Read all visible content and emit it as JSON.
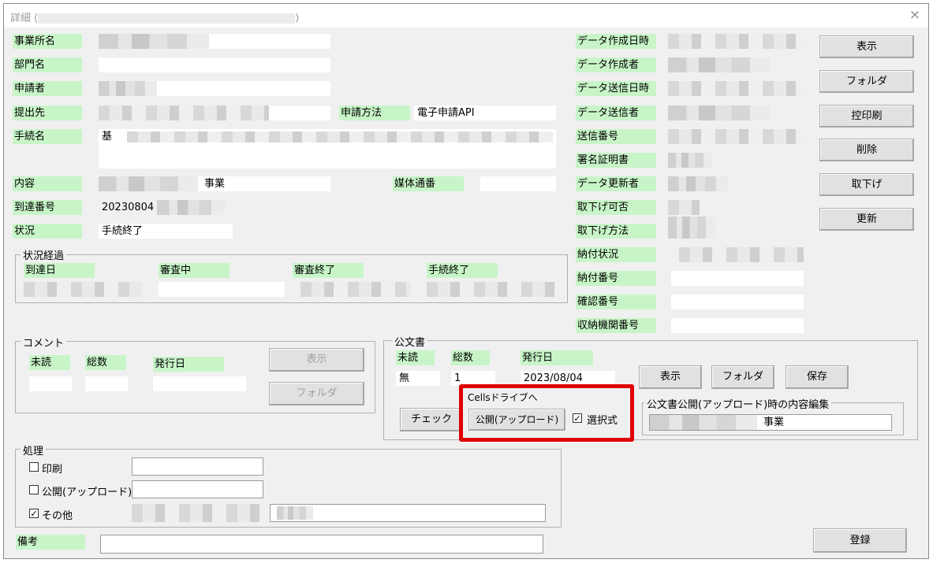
{
  "window": {
    "title": "詳細 (",
    "title_end": ")",
    "close": "×"
  },
  "labels": {
    "office": "事業所名",
    "dept": "部門名",
    "applicant": "申請者",
    "submit_to": "提出先",
    "procedure": "手続名",
    "content": "内容",
    "arrival_no": "到達番号",
    "status": "状況",
    "apply_method": "申請方法",
    "media_no": "媒体通番",
    "data_created_at": "データ作成日時",
    "data_creator": "データ作成者",
    "data_sent_at": "データ送信日時",
    "data_sender": "データ送信者",
    "send_no": "送信番号",
    "sig_cert": "署名証明書",
    "data_updater": "データ更新者",
    "withdraw_ok": "取下げ可否",
    "withdraw_method": "取下げ方法",
    "payment_status": "納付状況",
    "payment_no": "納付番号",
    "confirm_no": "確認番号",
    "receiver_no": "収納機関番号",
    "note": "備考"
  },
  "values": {
    "apply_method": "電子申請API",
    "procedure_prefix": "基",
    "content": "事業",
    "arrival_no": "20230804",
    "status": "手続終了"
  },
  "status_history": {
    "title": "状況経過",
    "headers": [
      "到達日",
      "審査中",
      "審査終了",
      "手続終了"
    ]
  },
  "comment": {
    "title": "コメント",
    "unread": "未読",
    "total": "総数",
    "issued": "発行日",
    "show": "表示",
    "folder": "フォルダ"
  },
  "official": {
    "title": "公文書",
    "unread": "未読",
    "total": "総数",
    "issued": "発行日",
    "unread_value": "無",
    "total_value": "1",
    "issued_value": "2023/08/04",
    "show": "表示",
    "folder": "フォルダ",
    "save": "保存",
    "check": "チェック",
    "cells_title": "Cellsドライブへ",
    "upload": "公開(アップロード)",
    "select": "選択式",
    "edit_title": "公文書公開(アップロード)時の内容編集",
    "edit_value": "事業"
  },
  "process": {
    "title": "処理",
    "print": "印刷",
    "upload": "公開(アップロード)",
    "other": "その他",
    "check_mark": "✓"
  },
  "side_buttons": [
    "表示",
    "フォルダ",
    "控印刷",
    "削除",
    "取下げ",
    "更新"
  ],
  "register": "登録",
  "colors": {
    "label_bg": "#c8f5c8",
    "highlight": "#e00000",
    "window_bg": "#f0f0f0"
  }
}
